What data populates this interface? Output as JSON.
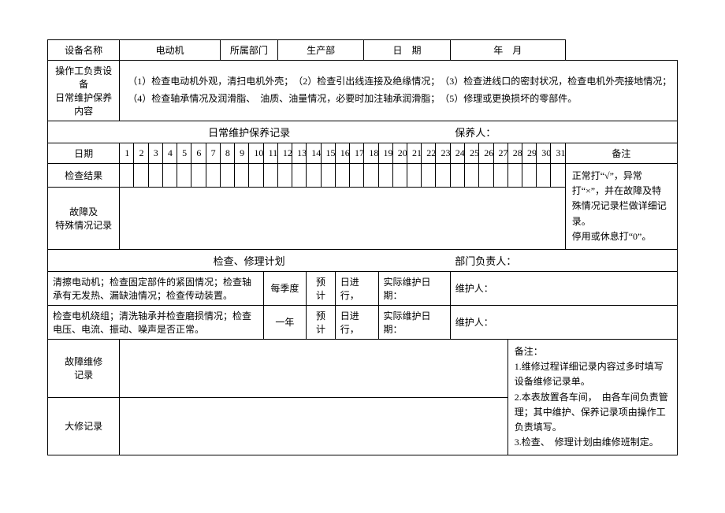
{
  "header": {
    "equip_name_label": "设备名称",
    "equip_name_value": "电动机",
    "dept_label": "所属部门",
    "dept_value": "生产部",
    "date_label": "日　期",
    "date_value": "年　月"
  },
  "content_row": {
    "label": "操作工负责设备\n日常维护保养内容",
    "line1": "（1）检查电动机外观，清扫电机外壳；　（2）检查引出线连接及绝缘情况；　（3）检查进线口的密封状况，检查电机外壳接地情况；",
    "line2": "（4）检查轴承情况及润滑脂、　油质、油量情况，必要时加注轴承润滑脂；　（5）修理或更换损坏的零部件。"
  },
  "daily_record": {
    "title": "日常维护保养记录",
    "maintainer_label": "保养人：",
    "date_label": "日期",
    "days": [
      "1",
      "2",
      "3",
      "4",
      "5",
      "6",
      "7",
      "8",
      "9",
      "10",
      "11",
      "12",
      "13",
      "14",
      "15",
      "16",
      "17",
      "18",
      "19",
      "20",
      "21",
      "22",
      "23",
      "24",
      "25",
      "26",
      "27",
      "28",
      "29",
      "30",
      "31"
    ],
    "result_label": "检查结果",
    "fault_label": "故障及\n特殊情况记录",
    "remark_label": "备注",
    "remark_text": "正常打“√”，异常打“×”，并在故障及特殊情况记录栏做详细记录。\n停用或休息打“0”。"
  },
  "plan": {
    "title": "检查、修理计划",
    "dept_head_label": "部门负责人：",
    "row1": {
      "desc": "清擦电动机；检查固定部件的紧固情况；检查轴承有无发热、漏缺油情况；检查传动装置。",
      "cycle": "每季度",
      "plan_label": "预计",
      "day_label": "日进行，",
      "actual_label": "实际维护日期：",
      "maint_label": "维护人："
    },
    "row2": {
      "desc": "检查电机绕组；清洗轴承并检查磨损情况；检查电压、电流、振动、噪声是否正常。",
      "cycle": "一年",
      "plan_label": "预计",
      "day_label": "日进行，",
      "actual_label": "实际维护日期：",
      "maint_label": "维护人："
    },
    "fault_repair_label": "故障维修\n记录",
    "overhaul_label": "大修记录",
    "side_notes_title": "备注：",
    "side_notes_1": "1.维修过程详细记录内容过多时填写设备维修记录单。",
    "side_notes_2": "2.本表放置各车间，　由各车间负责管理；其中维护、保养记录项由操作工负责填写。",
    "side_notes_3": "3.检查、　修理计划由维修班制定。"
  }
}
